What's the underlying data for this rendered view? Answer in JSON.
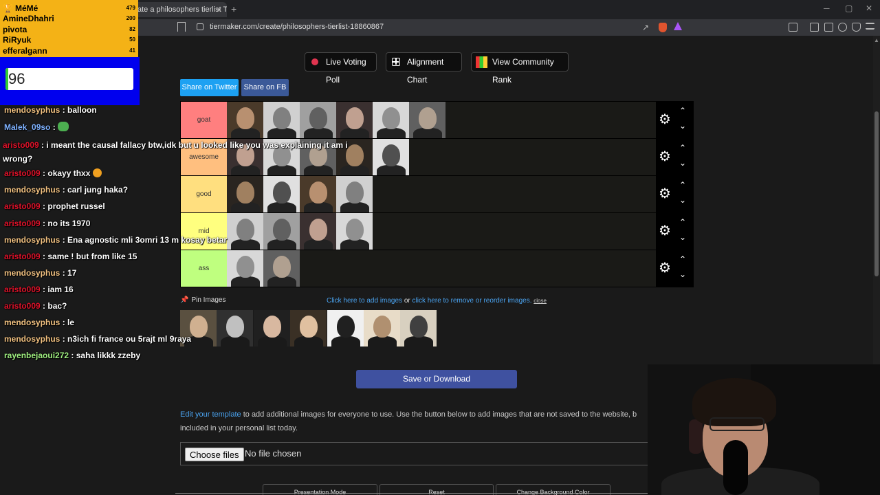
{
  "browser": {
    "tab_title": "ate a philosophers tierlist Ti",
    "tab_close": "×",
    "new_tab": "+",
    "url": "tiermaker.com/create/philosophers-tierlist-18860867",
    "window_min": "─",
    "window_max": "▢",
    "window_close": "✕"
  },
  "toolbar": {
    "live_voting": "Live Voting Poll",
    "alignment_chart": "Alignment Chart",
    "community_rank": "View Community Rank",
    "share_twitter": "Share on Twitter",
    "share_fb": "Share on FB"
  },
  "tiers": [
    {
      "label": "goat",
      "color": "#ff7f7f"
    },
    {
      "label": "awesome",
      "color": "#ffbf7f"
    },
    {
      "label": "good",
      "color": "#ffdf7f"
    },
    {
      "label": "mid",
      "color": "#ffff7f"
    },
    {
      "label": "ass",
      "color": "#bfff7f"
    }
  ],
  "tier_controls": {
    "gear": "⚙",
    "up": "⌃",
    "down": "⌄"
  },
  "pin": {
    "icon": "📌",
    "label": "Pin Images"
  },
  "add_images": {
    "add_link": "Click here to add images",
    "or": " or ",
    "remove_link": "click here to remove or reorder images.",
    "close": "close"
  },
  "save_button": "Save or Download",
  "edit": {
    "link": "Edit your template",
    "text": " to add additional images for everyone to use. Use the button below to add images that are not saved to the website, b included in your personal list today."
  },
  "file_input": {
    "button": "Choose files",
    "status": "No file chosen"
  },
  "bottom_buttons": [
    "Presentation Mode",
    "Reset",
    "Change Background Color"
  ],
  "leaderboard": [
    {
      "name": "MéMé",
      "score": "479",
      "trophy": "🏆"
    },
    {
      "name": "AmineDhahri",
      "score": "200"
    },
    {
      "name": "pivota",
      "score": "82"
    },
    {
      "name": "RiRyuk",
      "score": "50"
    },
    {
      "name": "efferalgann",
      "score": "41"
    }
  ],
  "vote": {
    "value": "96"
  },
  "chat": [
    {
      "user": "mendosyphus",
      "color": "#f0c080",
      "text": " : balloon"
    },
    {
      "user": "Malek_09so",
      "color": "#7fb2ff",
      "text": " : "
    },
    {
      "user": "aristo009",
      "color": "#e0122a",
      "text": " : i meant the causal fallacy btw,idk but u looked like you was explaining it am i wrong?"
    },
    {
      "user": "aristo009",
      "color": "#e0122a",
      "text": " : okayy thxx"
    },
    {
      "user": "mendosyphus",
      "color": "#f0c080",
      "text": " : carl jung haka?"
    },
    {
      "user": "aristo009",
      "color": "#e0122a",
      "text": " : prophet russel"
    },
    {
      "user": "aristo009",
      "color": "#e0122a",
      "text": " : no its 1970"
    },
    {
      "user": "mendosyphus",
      "color": "#f0c080",
      "text": " : Ena agnostic mli 3omri 13 m kosay betar"
    },
    {
      "user": "aristo009",
      "color": "#e0122a",
      "text": " : same ! but from like 15"
    },
    {
      "user": "mendosyphus",
      "color": "#f0c080",
      "text": " : 17"
    },
    {
      "user": "aristo009",
      "color": "#e0122a",
      "text": " : iam 16"
    },
    {
      "user": "aristo009",
      "color": "#e0122a",
      "text": " : bac?"
    },
    {
      "user": "mendosyphus",
      "color": "#f0c080",
      "text": " : le"
    },
    {
      "user": "mendosyphus",
      "color": "#f0c080",
      "text": " : n3ich fi france ou 5rajt ml 9raya"
    },
    {
      "user": "rayenbejaoui272",
      "color": "#a0f080",
      "text": " : saha likkk zzeby"
    }
  ]
}
